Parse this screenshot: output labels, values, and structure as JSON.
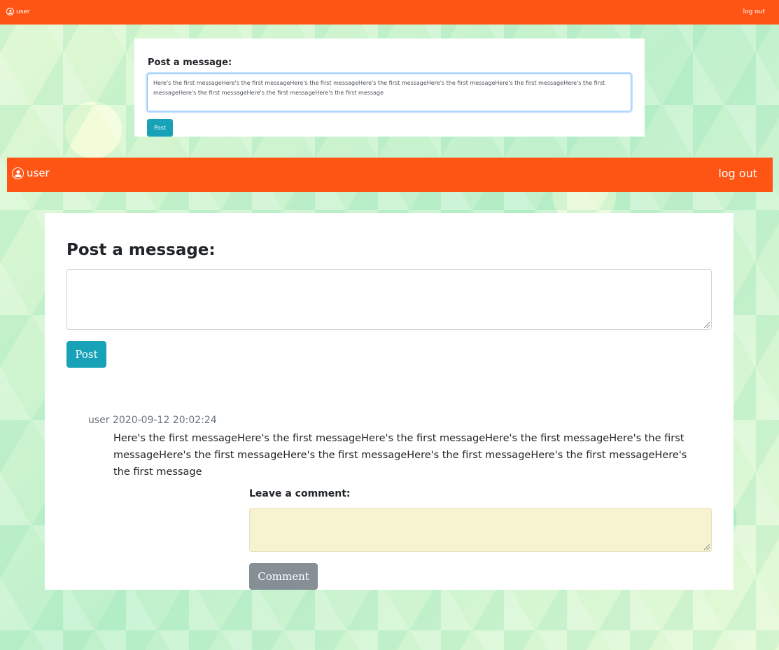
{
  "top_window": {
    "nav": {
      "user_label": "user",
      "logout_label": "log out"
    },
    "post_heading": "Post a message:",
    "textarea_value": "Here's the first messageHere's the first messageHere's the first messageHere's the first messageHere's the first messageHere's the first messageHere's the first messageHere's the first messageHere's the first messageHere's the first message",
    "post_button": "Post"
  },
  "bottom_window": {
    "nav": {
      "user_label": "user",
      "logout_label": "log out"
    },
    "post_heading": "Post a message:",
    "post_button": "Post",
    "message": {
      "meta": "user 2020-09-12 20:02:24",
      "body": "Here's the first messageHere's the first messageHere's the first messageHere's the first messageHere's the first messageHere's the first messageHere's the first messageHere's the first messageHere's the first messageHere's the first message"
    },
    "comment_label": "Leave a comment:",
    "comment_button": "Comment"
  },
  "colors": {
    "navbar": "#ff5514",
    "post_button": "#17a2b8",
    "comment_button": "#868e96",
    "comment_field": "#f7f3d0"
  },
  "icons": {
    "user": "user-circle-icon"
  }
}
